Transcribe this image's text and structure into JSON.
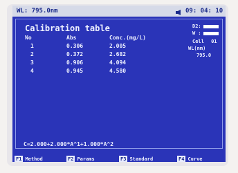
{
  "status_bar": {
    "wavelength": "WL: 795.0nm",
    "time": "09: 04: 10"
  },
  "title": "Calibration table",
  "side_panel": {
    "d2_label": "D2:",
    "w_label": "W :",
    "cell_label": "Cell",
    "cell_value": "01",
    "wl_label": "WL(nm)",
    "wl_value": "795.0"
  },
  "table": {
    "headers": [
      "No",
      "Abs",
      "Conc.(mg/L)"
    ],
    "rows": [
      [
        "1",
        "0.306",
        "2.005"
      ],
      [
        "2",
        "0.372",
        "2.682"
      ],
      [
        "3",
        "0.906",
        "4.094"
      ],
      [
        "4",
        "0.945",
        "4.580"
      ]
    ]
  },
  "formula": "C=2.000+2.000*A^1+1.000*A^2",
  "softkeys": [
    {
      "key": "F1",
      "label": "Method"
    },
    {
      "key": "F2",
      "label": "Params"
    },
    {
      "key": "F3",
      "label": "Standard"
    },
    {
      "key": "F4",
      "label": "Curve"
    }
  ]
}
